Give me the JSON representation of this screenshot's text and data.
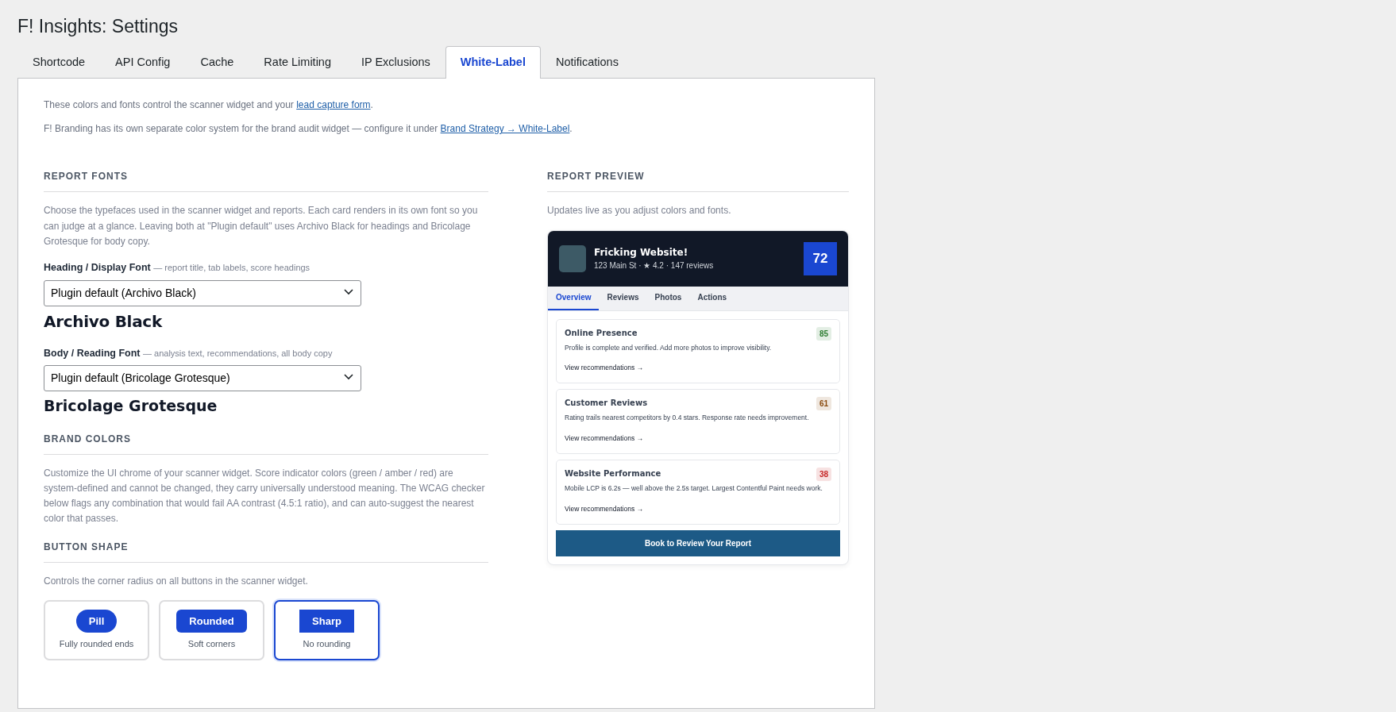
{
  "page_title": "F! Insights: Settings",
  "tabs": [
    {
      "label": "Shortcode",
      "selected": false
    },
    {
      "label": "API Config",
      "selected": false
    },
    {
      "label": "Cache",
      "selected": false
    },
    {
      "label": "Rate Limiting",
      "selected": false
    },
    {
      "label": "IP Exclusions",
      "selected": false
    },
    {
      "label": "White-Label",
      "selected": true
    },
    {
      "label": "Notifications",
      "selected": false
    }
  ],
  "intro": [
    {
      "text": "These colors and fonts control the scanner widget and your ",
      "link": "lead capture form",
      "after": "."
    },
    {
      "text": "F! Branding has its own separate color system for the brand audit widget — configure it under ",
      "link": "Brand Strategy → White-Label",
      "after": "."
    }
  ],
  "report_fonts": {
    "heading": "REPORT FONTS",
    "description": "Choose the typefaces used in the scanner widget and reports. Each card renders in its own font so you can judge at a glance. Leaving both at \"Plugin default\" uses Archivo Black for headings and Bricolage Grotesque for body copy.",
    "fields": [
      {
        "label": "Heading / Display Font",
        "hint": "— report title, tab labels, score headings",
        "value": "Plugin default (Archivo Black)",
        "sample": "Archivo Black",
        "kind": "display"
      },
      {
        "label": "Body / Reading Font",
        "hint": "— analysis text, recommendations, all body copy",
        "value": "Plugin default (Bricolage Grotesque)",
        "sample": "Bricolage Grotesque",
        "kind": "body"
      }
    ]
  },
  "brand_colors": {
    "heading": "BRAND COLORS",
    "description": "Customize the UI chrome of your scanner widget. Score indicator colors (green / amber / red) are system-defined and cannot be changed, they carry universally understood meaning. The WCAG checker below flags any combination that would fail AA contrast (4.5:1 ratio), and can auto-suggest the nearest color that passes."
  },
  "button_shape": {
    "heading": "BUTTON SHAPE",
    "description": "Controls the corner radius on all buttons in the scanner widget.",
    "options": [
      {
        "label": "Pill",
        "caption": "Fully rounded ends",
        "kind": "pill",
        "selected": false
      },
      {
        "label": "Rounded",
        "caption": "Soft corners",
        "kind": "rounded",
        "selected": false
      },
      {
        "label": "Sharp",
        "caption": "No rounding",
        "kind": "sharp",
        "selected": true
      }
    ]
  },
  "preview": {
    "heading": "REPORT PREVIEW",
    "description": "Updates live as you adjust colors and fonts.",
    "business": "Fricking Website!",
    "meta": "123 Main St · ★ 4.2 · 147 reviews",
    "score": "72",
    "tabs": [
      {
        "label": "Overview",
        "selected": true
      },
      {
        "label": "Reviews",
        "selected": false
      },
      {
        "label": "Photos",
        "selected": false
      },
      {
        "label": "Actions",
        "selected": false
      }
    ],
    "cards": [
      {
        "title": "Online Presence",
        "score": "85",
        "color": "#2e7d32",
        "text": "Profile is complete and verified. Add more photos to improve visibility.",
        "link": "View recommendations →"
      },
      {
        "title": "Customer Reviews",
        "score": "61",
        "color": "#8a4b0f",
        "text": "Rating trails nearest competitors by 0.4 stars. Response rate needs improvement.",
        "link": "View recommendations →"
      },
      {
        "title": "Website Performance",
        "score": "38",
        "color": "#c62828",
        "text": "Mobile LCP is 6.2s — well above the 2.5s target. Largest Contentful Paint needs work.",
        "link": "View recommendations →"
      }
    ],
    "cta": "Book to Review Your Report"
  }
}
